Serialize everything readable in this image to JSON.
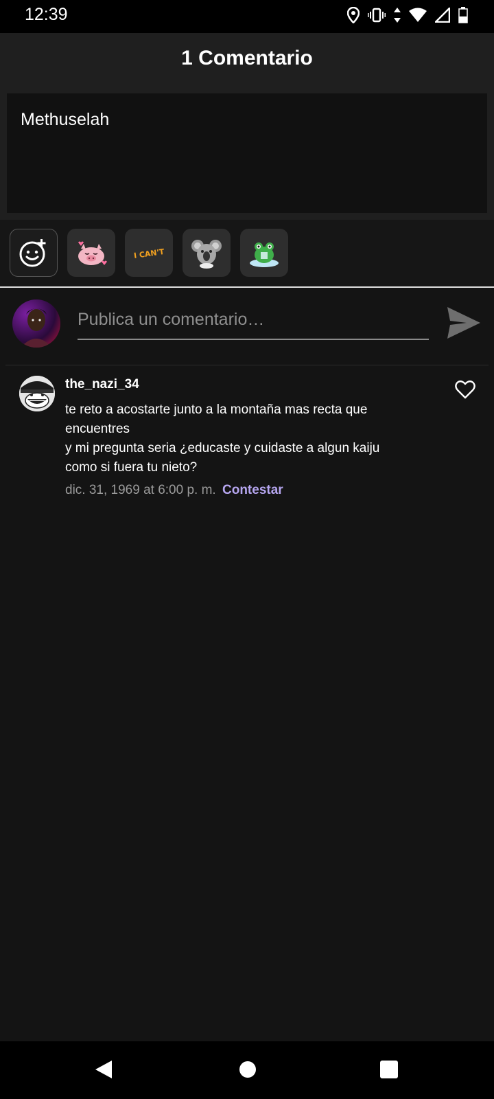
{
  "status_bar": {
    "time": "12:39",
    "icons": [
      "location-icon",
      "vibrate-icon",
      "data-arrows-icon",
      "wifi-icon",
      "signal-icon",
      "battery-icon"
    ]
  },
  "header": {
    "title": "1 Comentario"
  },
  "post": {
    "text": "Methuselah"
  },
  "stickers": [
    {
      "name": "emoji-add-icon"
    },
    {
      "name": "pig-sticker"
    },
    {
      "name": "i-cant-sticker",
      "text": "I CAN'T"
    },
    {
      "name": "koala-sticker"
    },
    {
      "name": "frog-sticker"
    }
  ],
  "compose": {
    "placeholder": "Publica un comentario…"
  },
  "comments": [
    {
      "username": "the_nazi_34",
      "lines": [
        "te reto a acostarte junto a la montaña mas recta que",
        "encuentres",
        "y mi pregunta seria ¿educaste y cuidaste a algun kaiju",
        "como si fuera tu nieto?"
      ],
      "timestamp": "dic. 31, 1969 at 6:00 p. m.",
      "reply_label": "Contestar"
    }
  ],
  "colors": {
    "background": "#141414",
    "header": "#1f1f1f",
    "accent": "#b6a6f0",
    "muted": "#9b9b9b"
  }
}
